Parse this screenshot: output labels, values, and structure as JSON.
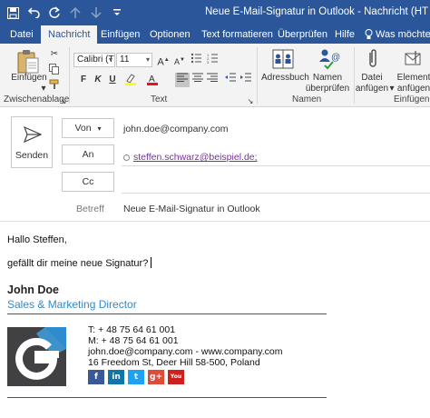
{
  "window": {
    "title": "Neue E-Mail-Signatur in Outlook  -  Nachricht (HT",
    "titlebar_color": "#2b579a"
  },
  "quick_access": [
    {
      "icon": "save-icon"
    },
    {
      "icon": "undo-icon"
    },
    {
      "icon": "redo-icon"
    },
    {
      "icon": "arrow-up-icon"
    },
    {
      "icon": "arrow-down-icon"
    },
    {
      "icon": "customize-dropdown-icon"
    }
  ],
  "tabs": [
    "Datei",
    "Nachricht",
    "Einfügen",
    "Optionen",
    "Text formatieren",
    "Überprüfen",
    "Hilfe"
  ],
  "active_tab": "Nachricht",
  "tell_me": "Was möchten",
  "ribbon": {
    "clipboard": {
      "paste_label": "Einfügen",
      "group_label": "Zwischenablage"
    },
    "basic_text": {
      "font_name": "Calibri (T",
      "font_size": "11",
      "bold": "F",
      "italic": "K",
      "underline": "U",
      "group_label": "Text"
    },
    "names": {
      "address_book_label": "Adressbuch",
      "check_names_line1": "Namen",
      "check_names_line2": "überprüfen",
      "group_label": "Namen"
    },
    "include": {
      "attach_line1": "Datei",
      "attach_line2": "anfügen",
      "item_line1": "Element",
      "item_line2": "anfügen",
      "group_label": "Einfügen"
    }
  },
  "compose": {
    "send_label": "Senden",
    "from_label": "Von",
    "from_value": "john.doe@company.com",
    "to_label": "An",
    "to_value": "steffen.schwarz@beispiel.de;",
    "cc_label": "Cc",
    "subject_label": "Betreff",
    "subject_value": "Neue E-Mail-Signatur in Outlook"
  },
  "body": {
    "greeting": "Hallo Steffen,",
    "line1": "gefällt dir meine neue Signatur?"
  },
  "signature": {
    "name": "John Doe",
    "role": "Sales & Marketing Director",
    "role_color": "#2e8bcf",
    "phone": "T: + 48 75 64 61 001",
    "mobile": "M: + 48 75 64 61 001",
    "email_web": "john.doe@company.com - www.company.com",
    "address": "16 Freedom St, Deer Hill 58-500, Poland",
    "logo_letter": "G",
    "socials": [
      {
        "icon": "facebook-icon",
        "glyph": "f",
        "color": "#3b5998"
      },
      {
        "icon": "linkedin-icon",
        "glyph": "in",
        "color": "#0e76a8"
      },
      {
        "icon": "twitter-icon",
        "glyph": "t",
        "color": "#1da1f2"
      },
      {
        "icon": "google-plus-icon",
        "glyph": "g+",
        "color": "#dd4b39"
      },
      {
        "icon": "youtube-icon",
        "glyph": "You",
        "color": "#cd201f"
      }
    ]
  }
}
